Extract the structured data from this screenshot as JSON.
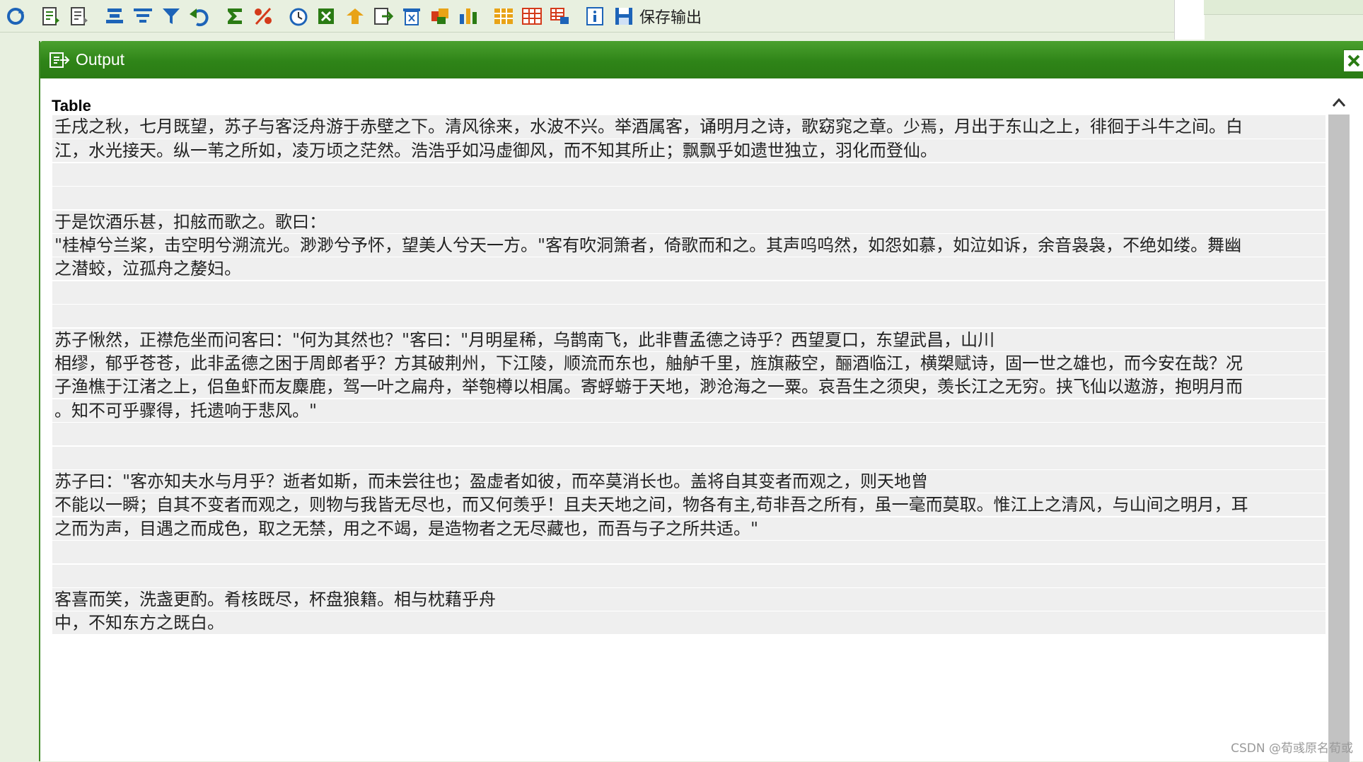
{
  "toolbar": {
    "icons": [
      "refresh-icon",
      "report-icon",
      "report-alt-icon",
      "align-icon",
      "filter-icon",
      "funnel-icon",
      "undo-icon",
      "sum-icon",
      "percent-icon",
      "clock-icon",
      "excel-icon",
      "arrow-icon",
      "export-icon",
      "delete-icon",
      "sort-icon",
      "chart-icon",
      "grid-icon",
      "grid-alt-icon",
      "grid-link-icon",
      "info-icon",
      "save-icon"
    ],
    "save_output_label": "保存输出"
  },
  "output_window": {
    "title": "Output",
    "close_icon": "close-icon",
    "section_label": "Table",
    "lines": [
      {
        "text": "壬戌之秋，七月既望，苏子与客泛舟游于赤壁之下。清风徐来，水波不兴。举酒属客，诵明月之诗，歌窈窕之章。少焉，月出于东山之上，徘徊于斗牛之间。白",
        "shaded": true
      },
      {
        "text": "江，水光接天。纵一苇之所如，凌万顷之茫然。浩浩乎如冯虚御风，而不知其所止；飘飘乎如遗世独立，羽化而登仙。",
        "shaded": true
      },
      {
        "text": "",
        "shaded": true
      },
      {
        "text": "",
        "shaded": true
      },
      {
        "text": "于是饮酒乐甚，扣舷而歌之。歌曰：",
        "shaded": true
      },
      {
        "text": "\"桂棹兮兰桨，击空明兮溯流光。渺渺兮予怀，望美人兮天一方。\"客有吹洞箫者，倚歌而和之。其声呜呜然，如怨如慕，如泣如诉，余音袅袅，不绝如缕。舞幽",
        "shaded": true
      },
      {
        "text": "之潜蛟，泣孤舟之嫠妇。",
        "shaded": true
      },
      {
        "text": "",
        "shaded": true
      },
      {
        "text": "",
        "shaded": true
      },
      {
        "text": "苏子愀然，正襟危坐而问客曰：\"何为其然也？\"客曰：\"月明星稀，乌鹊南飞，此非曹孟德之诗乎？西望夏口，东望武昌，山川",
        "shaded": true
      },
      {
        "text": "相缪，郁乎苍苍，此非孟德之困于周郎者乎？方其破荆州，下江陵，顺流而东也，舳舻千里，旌旗蔽空，酾酒临江，横槊赋诗，固一世之雄也，而今安在哉？况",
        "shaded": true
      },
      {
        "text": "子渔樵于江渚之上，侣鱼虾而友麋鹿，驾一叶之扁舟，举匏樽以相属。寄蜉蝣于天地，渺沧海之一粟。哀吾生之须臾，羡长江之无穷。挟飞仙以遨游，抱明月而",
        "shaded": true
      },
      {
        "text": "。知不可乎骤得，托遗响于悲风。\"",
        "shaded": true
      },
      {
        "text": "",
        "shaded": true
      },
      {
        "text": "",
        "shaded": true
      },
      {
        "text": "苏子曰：\"客亦知夫水与月乎？逝者如斯，而未尝往也；盈虚者如彼，而卒莫消长也。盖将自其变者而观之，则天地曾",
        "shaded": true
      },
      {
        "text": "不能以一瞬；自其不变者而观之，则物与我皆无尽也，而又何羡乎！且夫天地之间，物各有主,苟非吾之所有，虽一毫而莫取。惟江上之清风，与山间之明月，耳",
        "shaded": true
      },
      {
        "text": "之而为声，目遇之而成色，取之无禁，用之不竭，是造物者之无尽藏也，而吾与子之所共适。\"",
        "shaded": true
      },
      {
        "text": "",
        "shaded": true
      },
      {
        "text": "",
        "shaded": true
      },
      {
        "text": "客喜而笑，洗盏更酌。肴核既尽，杯盘狼籍。相与枕藉乎舟",
        "shaded": true
      },
      {
        "text": "中，不知东方之既白。",
        "shaded": true
      }
    ]
  },
  "scrollbar": {
    "up_icon": "chevron-up-icon"
  },
  "watermark": "CSDN @荀彧原名荀或"
}
